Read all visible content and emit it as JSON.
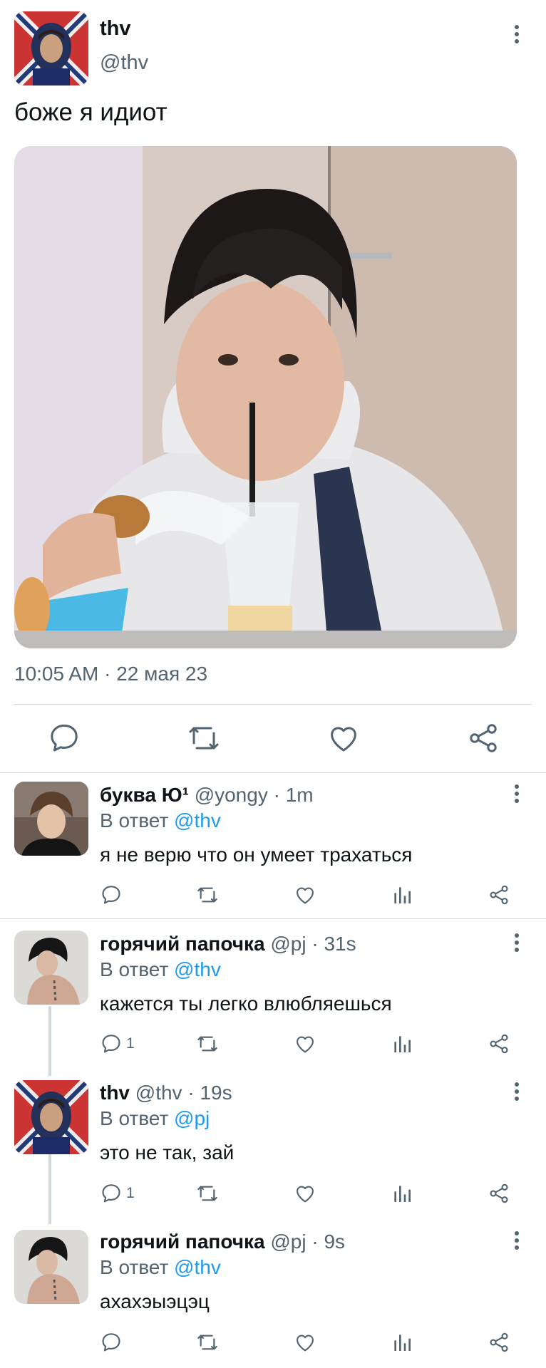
{
  "tweet": {
    "name": "thv",
    "handle": "@thv",
    "text": "боже я идиот",
    "time": "10:05 AM",
    "date": "22 мая 23"
  },
  "replies": [
    {
      "name": "буква Ю¹",
      "handle": "@yongy",
      "time": "1m",
      "reply_prefix": "В ответ",
      "reply_to": "@thv",
      "text": "я не верю что он умеет трахаться",
      "reply_count": ""
    },
    {
      "name": "горячий папочка",
      "handle": "@pj",
      "time": "31s",
      "reply_prefix": "В ответ",
      "reply_to": "@thv",
      "text": "кажется ты легко влюбляешься",
      "reply_count": "1"
    },
    {
      "name": "thv",
      "handle": "@thv",
      "time": "19s",
      "reply_prefix": "В ответ",
      "reply_to": "@pj",
      "text": "это не так, зай",
      "reply_count": "1"
    },
    {
      "name": "горячий папочка",
      "handle": "@pj",
      "time": "9s",
      "reply_prefix": "В ответ",
      "reply_to": "@thv",
      "text": "ахахэыэцэц",
      "reply_count": ""
    }
  ],
  "separator": " · ",
  "colors": {
    "accent": "#1d9bf0",
    "secondary": "#536471",
    "divider": "#cfd9de"
  },
  "icons": [
    "comment-icon",
    "retweet-icon",
    "like-icon",
    "analytics-icon",
    "share-icon",
    "more-icon"
  ]
}
